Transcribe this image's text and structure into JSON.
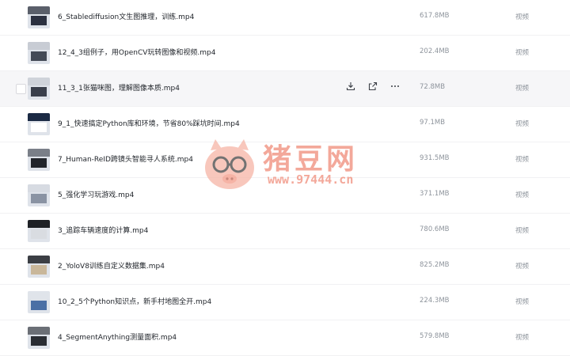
{
  "files": [
    {
      "name": "6_Stablediffusion文生图推理，训练.mp4",
      "size": "617.8MB",
      "type": "视频",
      "thumb": [
        "#5a5f6a",
        "#2c3140"
      ]
    },
    {
      "name": "12_4_3组例子，用OpenCV玩转图像和视频.mp4",
      "size": "202.4MB",
      "type": "视频",
      "thumb": [
        "#c8ccd4",
        "#444a56"
      ]
    },
    {
      "name": "11_3_1张猫咪图，理解图像本质.mp4",
      "size": "72.8MB",
      "type": "视频",
      "thumb": [
        "#cfd3da",
        "#3a3f4b"
      ],
      "hovered": true
    },
    {
      "name": "9_1_快速搞定Python库和环境，节省80%踩坑时间.mp4",
      "size": "97.1MB",
      "type": "视频",
      "thumb": [
        "#1b2a44",
        "#ffffff"
      ]
    },
    {
      "name": "7_Human-ReID跨镜头智能寻人系统.mp4",
      "size": "931.5MB",
      "type": "视频",
      "thumb": [
        "#7a7f88",
        "#22252b"
      ]
    },
    {
      "name": "5_强化学习玩游戏.mp4",
      "size": "371.1MB",
      "type": "视频",
      "thumb": [
        "#d7dbe2",
        "#8a93a3"
      ]
    },
    {
      "name": "3_追踪车辆速度的计算.mp4",
      "size": "780.6MB",
      "type": "视频",
      "thumb": [
        "#1e2126",
        "#d9dce1"
      ]
    },
    {
      "name": "2_YoloV8训练自定义数据集.mp4",
      "size": "825.2MB",
      "type": "视频",
      "thumb": [
        "#3b3e44",
        "#c9b79a"
      ]
    },
    {
      "name": "10_2_5个Python知识点，新手村地图全开.mp4",
      "size": "224.3MB",
      "type": "视频",
      "thumb": [
        "#e0e4ea",
        "#4a6fa5"
      ]
    },
    {
      "name": "4_SegmentAnything测量面积.mp4",
      "size": "579.8MB",
      "type": "视频",
      "thumb": [
        "#6b6f76",
        "#2a2d33"
      ]
    }
  ],
  "watermark": {
    "text": "猪豆网",
    "url": "www.97444.cn"
  },
  "colors": {
    "watermark": "#f08b79",
    "hover_row": "#f6f6f8"
  },
  "icons": {
    "download": "download-icon",
    "share": "share-icon",
    "more": "more-icon"
  }
}
